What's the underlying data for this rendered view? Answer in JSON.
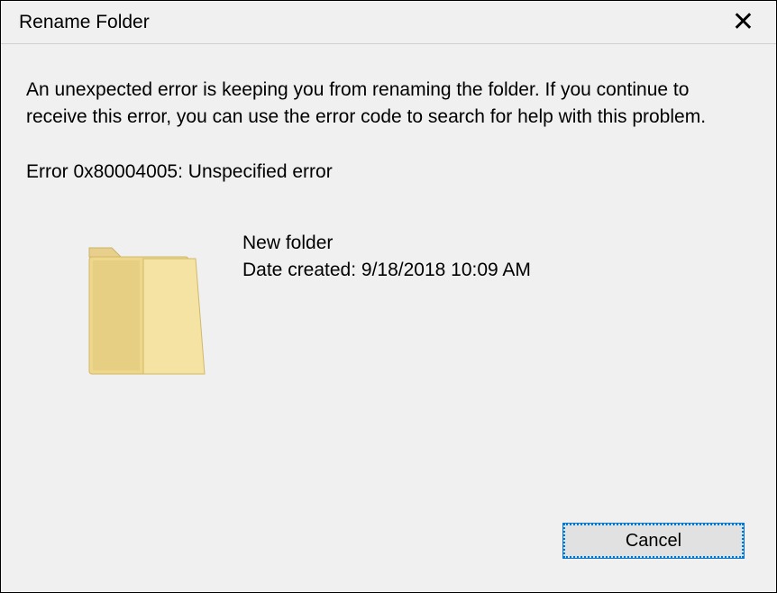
{
  "titlebar": {
    "title": "Rename Folder"
  },
  "body": {
    "error_message": "An unexpected error is keeping you from renaming the folder. If you continue to receive this error, you can use the error code to search for help with this problem.",
    "error_code": "Error 0x80004005: Unspecified error",
    "item": {
      "name": "New folder",
      "date_label": "Date created: 9/18/2018 10:09 AM"
    }
  },
  "buttons": {
    "cancel": "Cancel"
  }
}
